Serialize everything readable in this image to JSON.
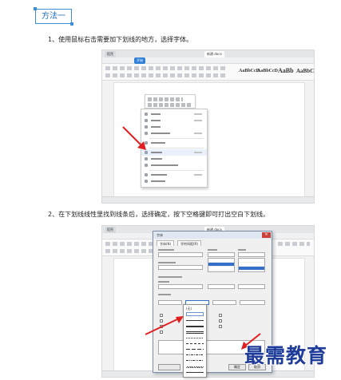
{
  "heading": {
    "tag": "方法一"
  },
  "steps": [
    {
      "text": "1、使用鼠标右击需要加下划线的地方，选择字体。"
    },
    {
      "text": "2、在下划线线性里找到线条后，选择确定，按下空格键即可打出空白下划线。"
    }
  ],
  "screenshot1": {
    "tabs": [
      {
        "label": "稻壳"
      },
      {
        "label": "新建.docx"
      }
    ],
    "ribbon_start_tab": "开始",
    "style_samples": [
      "AaBbCcD",
      "AaBbCcD",
      "AaBb",
      "AaBbC"
    ],
    "highlighted_menu_item_index": 7
  },
  "screenshot2": {
    "dialog_title": "字体",
    "dialog_tabs": [
      {
        "label": "字体(N)"
      },
      {
        "label": "字符间距(R)"
      }
    ],
    "underline_none_label": "(无)",
    "ok_button": "确定",
    "cancel_button": "取消"
  },
  "watermark": "最需教育",
  "colors": {
    "accent_blue": "#3f8fd8",
    "arrow_red": "#e02020",
    "watermark_blue": "#1f3c9a"
  }
}
